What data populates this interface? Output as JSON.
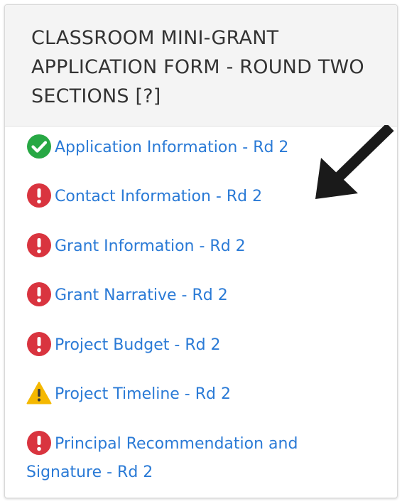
{
  "panel": {
    "title": "CLASSROOM MINI-GRANT APPLICATION FORM - ROUND TWO SECTIONS",
    "help": "[?]"
  },
  "sections": [
    {
      "label": "Application Information - Rd 2",
      "status": "complete",
      "icon": "check-circle-icon"
    },
    {
      "label": "Contact Information - Rd 2",
      "status": "error",
      "icon": "exclamation-circle-icon"
    },
    {
      "label": "Grant Information - Rd 2",
      "status": "error",
      "icon": "exclamation-circle-icon"
    },
    {
      "label": "Grant Narrative - Rd 2",
      "status": "error",
      "icon": "exclamation-circle-icon"
    },
    {
      "label": "Project Budget - Rd 2",
      "status": "error",
      "icon": "exclamation-circle-icon"
    },
    {
      "label": "Project Timeline - Rd 2",
      "status": "warning",
      "icon": "warning-triangle-icon"
    },
    {
      "label": "Principal Recommendation and Signature - Rd 2",
      "status": "error",
      "icon": "exclamation-circle-icon"
    }
  ],
  "colors": {
    "link": "#2a7ad6",
    "complete": "#27a844",
    "error": "#d9343f",
    "warning": "#f5b800",
    "header_bg": "#f4f4f4"
  },
  "annotation": {
    "icon": "arrow-pointer-icon"
  }
}
